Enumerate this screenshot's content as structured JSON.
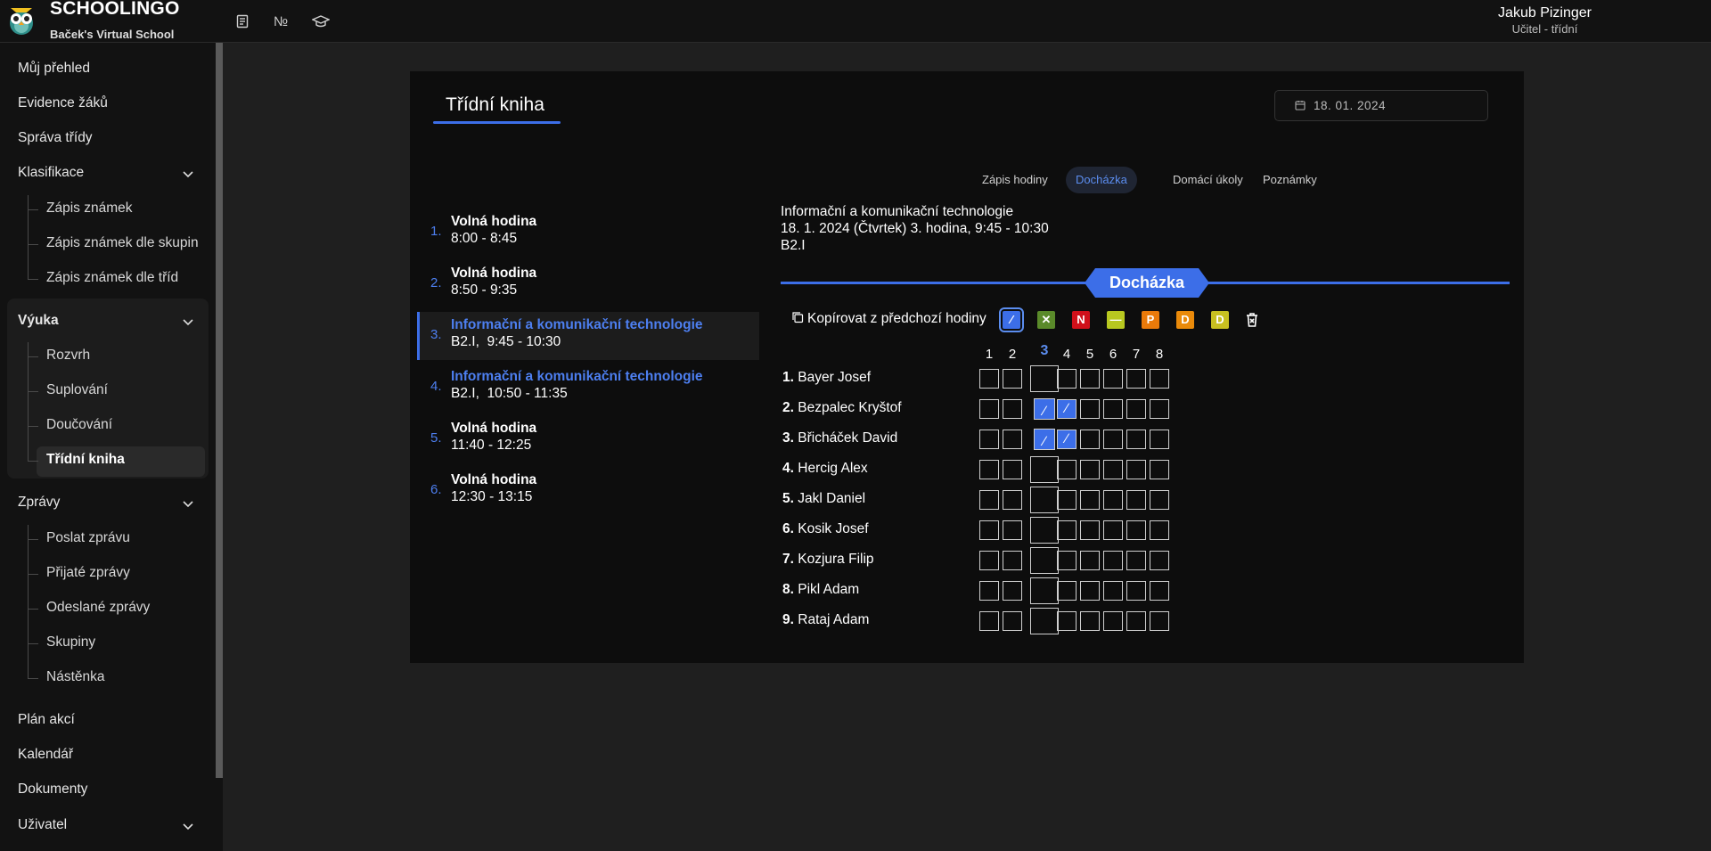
{
  "app": {
    "brand": "SCHOOLINGO",
    "school": "Baček's Virtual School",
    "icons": [
      "notebook-icon",
      "numero-icon",
      "graduation-cap-icon"
    ],
    "numero_glyph": "№"
  },
  "user": {
    "name": "Jakub Pizinger",
    "role": "Učitel - třídní"
  },
  "sidebar": {
    "top_items": [
      "Můj přehled",
      "Evidence žáků",
      "Správa třídy"
    ],
    "klasifikace": {
      "label": "Klasifikace",
      "items": [
        "Zápis známek",
        "Zápis známek dle skupin",
        "Zápis známek dle tříd"
      ]
    },
    "vyuka": {
      "label": "Výuka",
      "items": [
        "Rozvrh",
        "Suplování",
        "Doučování",
        "Třídní kniha"
      ],
      "active": "Třídní kniha"
    },
    "zpravy": {
      "label": "Zprávy",
      "items": [
        "Poslat zprávu",
        "Přijaté zprávy",
        "Odeslané zprávy",
        "Skupiny",
        "Nástěnka"
      ]
    },
    "bottom_items": [
      "Plán akcí",
      "Kalendář",
      "Dokumenty"
    ],
    "uzivatel": {
      "label": "Uživatel"
    }
  },
  "page": {
    "title": "Třídní kniha",
    "date": "18.  01.  2024",
    "tabs": [
      "Zápis hodiny",
      "Docházka",
      "Domácí úkoly",
      "Poznámky"
    ],
    "active_tab": "Docházka"
  },
  "lessons": [
    {
      "num": "1.",
      "title": "Volná hodina",
      "sub": "8:00 - 8:45",
      "highlight": false
    },
    {
      "num": "2.",
      "title": "Volná hodina",
      "sub": "8:50 - 9:35",
      "highlight": false
    },
    {
      "num": "3.",
      "title": "Informační a komunikační technologie",
      "sub": "B2.I,  9:45 - 10:30",
      "highlight": true
    },
    {
      "num": "4.",
      "title": "Informační a komunikační technologie",
      "sub": "B2.I,  10:50 - 11:35",
      "highlight": true
    },
    {
      "num": "5.",
      "title": "Volná hodina",
      "sub": "11:40 - 12:25",
      "highlight": false
    },
    {
      "num": "6.",
      "title": "Volná hodina",
      "sub": "12:30 - 13:15",
      "highlight": false
    }
  ],
  "active_lesson": 3,
  "detail": {
    "subject": "Informační a komunikační technologie",
    "when": "18. 1. 2024 (Čtvrtek) 3. hodina, 9:45 - 10:30",
    "class": "B2.I"
  },
  "attendance": {
    "section_title": "Docházka",
    "copy_label": "Kopírovat z předchozí hodiny",
    "chips": [
      {
        "label": "∕",
        "color": "#3c6ee8",
        "selected": true
      },
      {
        "label": "✕",
        "color": "#5a8a2a",
        "selected": false
      },
      {
        "label": "N",
        "color": "#d0101a",
        "selected": false
      },
      {
        "label": "—",
        "color": "#b8c820",
        "selected": false
      },
      {
        "label": "P",
        "color": "#ea7a0a",
        "selected": false
      },
      {
        "label": "D",
        "color": "#ea8a0a",
        "selected": false
      },
      {
        "label": "D",
        "color": "#c8c020",
        "selected": false
      }
    ],
    "columns": [
      "1",
      "2",
      "3",
      "4",
      "5",
      "6",
      "7",
      "8"
    ],
    "current_column": 3,
    "students": [
      {
        "num": "1.",
        "name": "Bayer Josef",
        "absent": []
      },
      {
        "num": "2.",
        "name": "Bezpalec Kryštof",
        "absent": [
          3,
          4
        ]
      },
      {
        "num": "3.",
        "name": "Břicháček David",
        "absent": [
          3,
          4
        ]
      },
      {
        "num": "4.",
        "name": "Hercig Alex",
        "absent": []
      },
      {
        "num": "5.",
        "name": "Jakl Daniel",
        "absent": []
      },
      {
        "num": "6.",
        "name": "Kosik Josef",
        "absent": []
      },
      {
        "num": "7.",
        "name": "Kozjura Filip",
        "absent": []
      },
      {
        "num": "8.",
        "name": "Pikl Adam",
        "absent": []
      },
      {
        "num": "9.",
        "name": "Rataj Adam",
        "absent": []
      }
    ]
  }
}
